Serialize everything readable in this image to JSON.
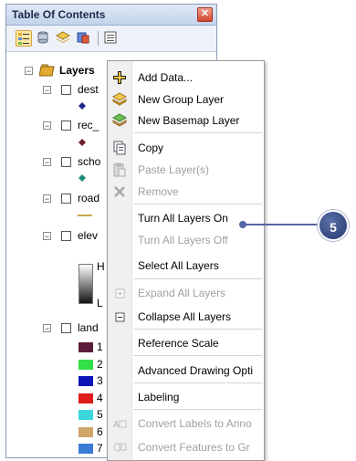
{
  "window": {
    "title": "Table Of Contents",
    "close_glyph": "✕"
  },
  "toolbar": {
    "buttons": [
      {
        "icon": "list-by-drawing-order-icon"
      },
      {
        "icon": "list-by-source-icon"
      },
      {
        "icon": "list-by-visibility-icon"
      },
      {
        "icon": "list-by-selection-icon"
      },
      {
        "icon": "options-icon"
      }
    ]
  },
  "tree": {
    "root_label": "Layers",
    "layers": [
      {
        "label": "dest"
      },
      {
        "label": "rec_"
      },
      {
        "label": "scho"
      },
      {
        "label": "road"
      },
      {
        "label": "elev"
      },
      {
        "label": "land"
      }
    ],
    "elev_legend": {
      "high": "H",
      "low": "L"
    },
    "land_classes": [
      {
        "label": "1",
        "color": "#5c1d3a"
      },
      {
        "label": "2",
        "color": "#33e04a"
      },
      {
        "label": "3",
        "color": "#0b14b4"
      },
      {
        "label": "4",
        "color": "#e01b1b"
      },
      {
        "label": "5",
        "color": "#3ad6dc"
      },
      {
        "label": "6",
        "color": "#cfa56a"
      },
      {
        "label": "7",
        "color": "#3b7bd8"
      }
    ]
  },
  "context_menu": {
    "items": [
      {
        "label": "Add Data...",
        "icon": "add-data-icon",
        "disabled": false
      },
      {
        "label": "New Group Layer",
        "icon": "group-layer-icon",
        "disabled": false
      },
      {
        "label": "New Basemap Layer",
        "icon": "basemap-layer-icon",
        "disabled": false
      },
      {
        "label": "Copy",
        "icon": "copy-icon",
        "disabled": false
      },
      {
        "label": "Paste Layer(s)",
        "icon": "paste-icon",
        "disabled": true
      },
      {
        "label": "Remove",
        "icon": "remove-icon",
        "disabled": true
      },
      {
        "label": "Turn All Layers On",
        "icon": "",
        "disabled": false
      },
      {
        "label": "Turn All Layers Off",
        "icon": "",
        "disabled": true
      },
      {
        "label": "Select All Layers",
        "icon": "",
        "disabled": false
      },
      {
        "label": "Expand All Layers",
        "icon": "expand-icon",
        "disabled": true
      },
      {
        "label": "Collapse All Layers",
        "icon": "collapse-icon",
        "disabled": false
      },
      {
        "label": "Reference Scale",
        "icon": "",
        "disabled": false
      },
      {
        "label": "Advanced Drawing Opti",
        "icon": "",
        "disabled": false
      },
      {
        "label": "Labeling",
        "icon": "",
        "disabled": false
      },
      {
        "label": "Convert Labels to Anno",
        "icon": "convert-labels-icon",
        "disabled": true
      },
      {
        "label": "Convert Features to Gr",
        "icon": "convert-features-icon",
        "disabled": true
      }
    ]
  },
  "callout": {
    "number": "5"
  }
}
